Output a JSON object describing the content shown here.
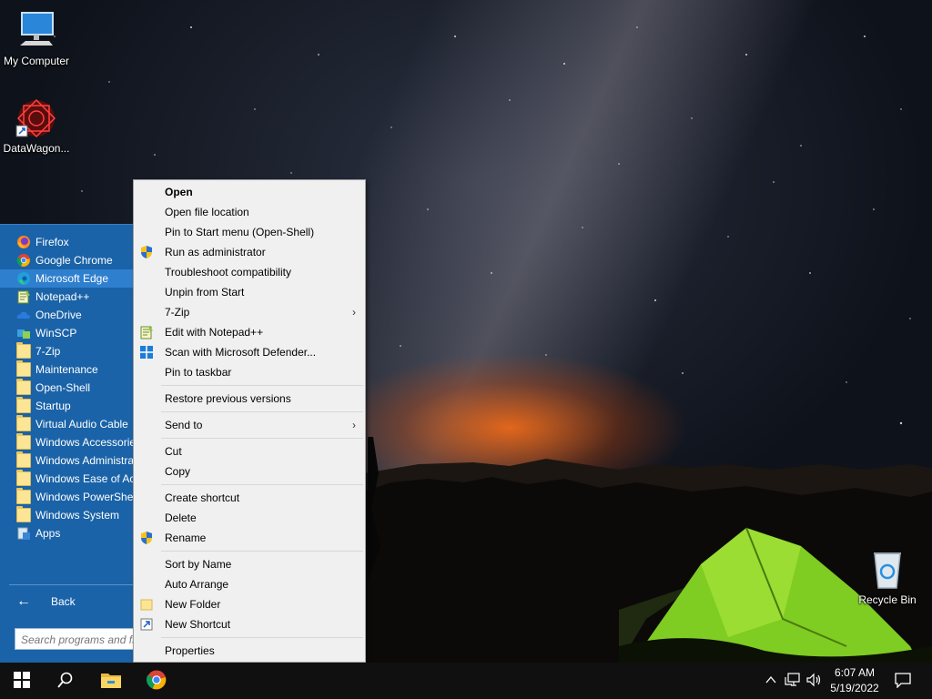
{
  "desktop": {
    "icons": [
      {
        "label": "My Computer"
      },
      {
        "label": "DataWagon..."
      },
      {
        "label": "Recycle Bin"
      }
    ]
  },
  "start_menu": {
    "programs": [
      {
        "label": "Firefox",
        "icon": "firefox-icon"
      },
      {
        "label": "Google Chrome",
        "icon": "chrome-icon"
      },
      {
        "label": "Microsoft Edge",
        "icon": "edge-icon"
      },
      {
        "label": "Notepad++",
        "icon": "notepadpp-icon"
      },
      {
        "label": "OneDrive",
        "icon": "onedrive-icon"
      },
      {
        "label": "WinSCP",
        "icon": "winscp-icon"
      },
      {
        "label": "7-Zip",
        "icon": "folder-icon"
      },
      {
        "label": "Maintenance",
        "icon": "folder-icon"
      },
      {
        "label": "Open-Shell",
        "icon": "folder-icon"
      },
      {
        "label": "Startup",
        "icon": "folder-icon"
      },
      {
        "label": "Virtual Audio Cable",
        "icon": "folder-icon"
      },
      {
        "label": "Windows Accessories",
        "icon": "folder-icon"
      },
      {
        "label": "Windows Administrative Tools",
        "icon": "folder-icon"
      },
      {
        "label": "Windows Ease of Access",
        "icon": "folder-icon"
      },
      {
        "label": "Windows PowerShell",
        "icon": "folder-icon"
      },
      {
        "label": "Windows System",
        "icon": "folder-icon"
      },
      {
        "label": "Apps",
        "icon": "apps-icon"
      }
    ],
    "back_label": "Back",
    "search_placeholder": "Search programs and files"
  },
  "context_menu": {
    "items": [
      {
        "label": "Open"
      },
      {
        "label": "Open file location"
      },
      {
        "label": "Pin to Start menu (Open-Shell)"
      },
      {
        "label": "Run as administrator"
      },
      {
        "label": "Troubleshoot compatibility"
      },
      {
        "label": "Unpin from Start"
      },
      {
        "label": "7-Zip"
      },
      {
        "label": "Edit with Notepad++"
      },
      {
        "label": "Scan with Microsoft Defender..."
      },
      {
        "label": "Pin to taskbar"
      },
      {
        "label": "Restore previous versions"
      },
      {
        "label": "Send to"
      },
      {
        "label": "Cut"
      },
      {
        "label": "Copy"
      },
      {
        "label": "Create shortcut"
      },
      {
        "label": "Delete"
      },
      {
        "label": "Rename"
      },
      {
        "label": "Sort by Name"
      },
      {
        "label": "Auto Arrange"
      },
      {
        "label": "New Folder"
      },
      {
        "label": "New Shortcut"
      },
      {
        "label": "Properties"
      }
    ]
  },
  "taskbar": {
    "time": "6:07 AM",
    "date": "5/19/2022"
  },
  "colors": {
    "start_menu_bg": "#1a63a8",
    "start_highlight": "#2f7fcf",
    "context_bg": "#f0f0f0",
    "taskbar_bg": "#101010"
  }
}
